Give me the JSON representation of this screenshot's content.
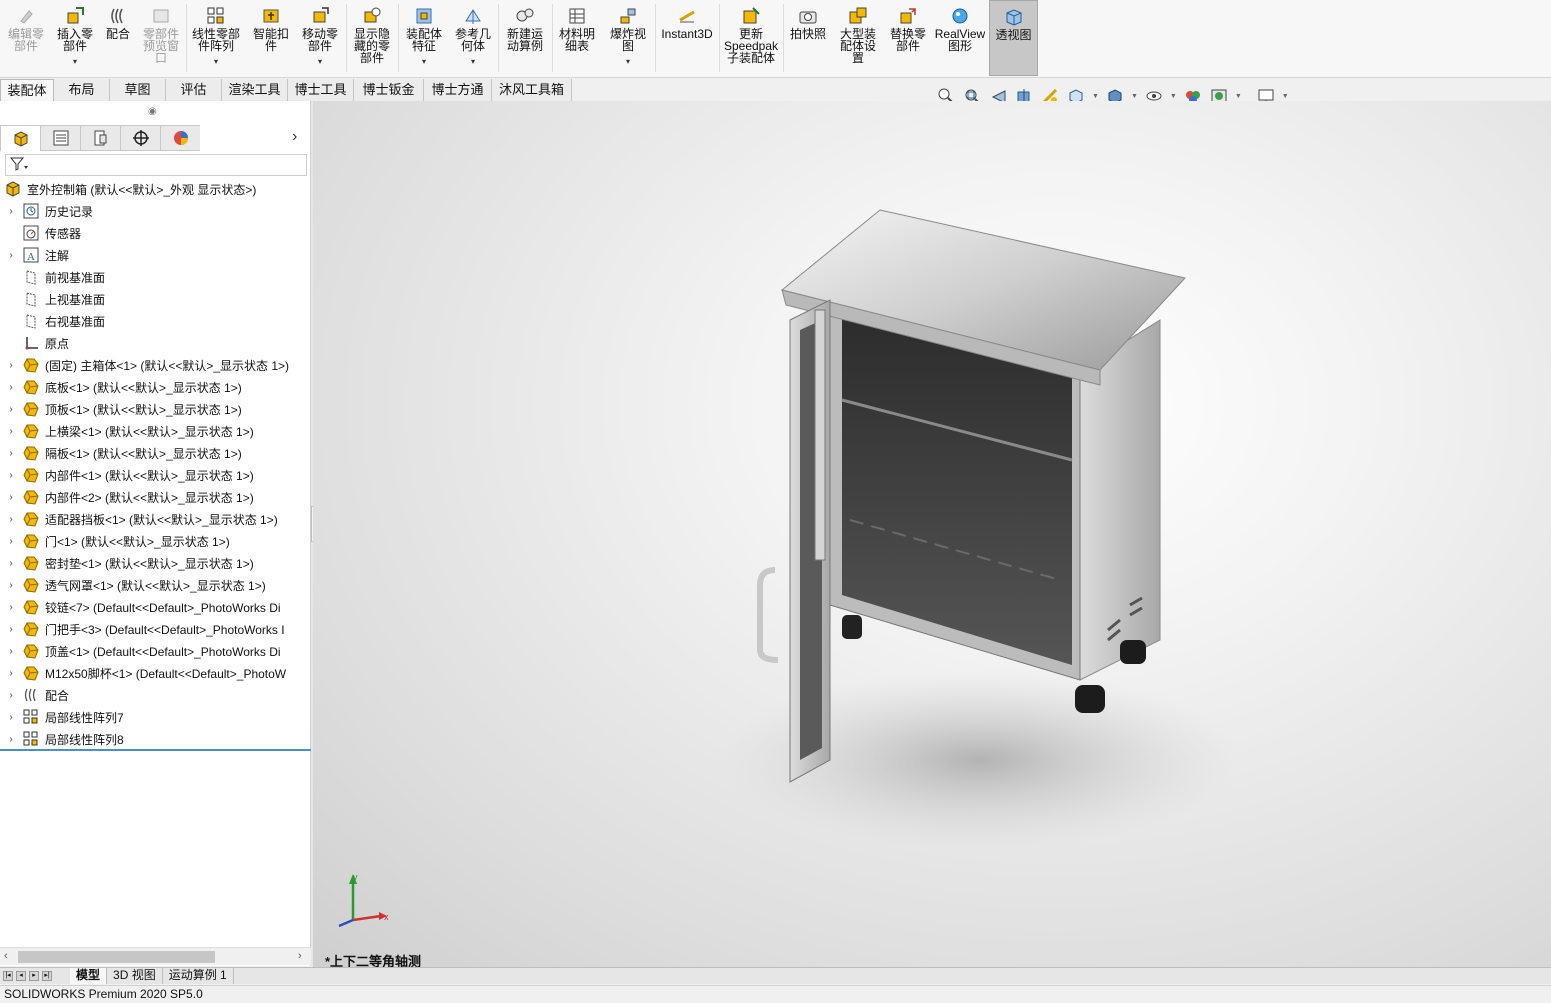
{
  "ribbon": {
    "buttons": [
      {
        "label": "编辑零\n部件",
        "icon": "edit-component-icon",
        "disabled": true
      },
      {
        "label": "插入零\n部件",
        "icon": "insert-component-icon",
        "dropdown": true
      },
      {
        "label": "配合",
        "icon": "mate-icon"
      },
      {
        "label": "零部件\n预览窗\n口",
        "icon": "preview-window-icon",
        "disabled": true
      },
      {
        "label": "线性零部\n件阵列",
        "icon": "linear-pattern-icon",
        "dropdown": true
      },
      {
        "label": "智能扣\n件",
        "icon": "smart-fastener-icon"
      },
      {
        "label": "移动零\n部件",
        "icon": "move-component-icon",
        "dropdown": true
      },
      {
        "label": "显示隐\n藏的零\n部件",
        "icon": "show-hidden-icon"
      },
      {
        "label": "装配体\n特征",
        "icon": "assembly-feature-icon",
        "dropdown": true
      },
      {
        "label": "参考几\n何体",
        "icon": "reference-geometry-icon",
        "dropdown": true
      },
      {
        "label": "新建运\n动算例",
        "icon": "motion-study-icon"
      },
      {
        "label": "材料明\n细表",
        "icon": "bom-icon"
      },
      {
        "label": "爆炸视\n图",
        "icon": "exploded-view-icon",
        "dropdown": true
      },
      {
        "label": "Instant3D",
        "icon": "instant3d-icon"
      },
      {
        "label": "更新\nSpeedpak\n子装配体",
        "icon": "speedpak-icon"
      },
      {
        "label": "拍快照",
        "icon": "snapshot-icon"
      },
      {
        "label": "大型装\n配体设\n置",
        "icon": "large-assembly-icon"
      },
      {
        "label": "替换零\n部件",
        "icon": "replace-component-icon"
      },
      {
        "label": "RealView\n图形",
        "icon": "realview-icon"
      },
      {
        "label": "透视图",
        "icon": "perspective-icon",
        "active": true
      }
    ]
  },
  "command_tabs": [
    "装配体",
    "布局",
    "草图",
    "评估",
    "渲染工具",
    "博士工具",
    "博士钣金",
    "博士方通",
    "沐风工具箱"
  ],
  "heads_up": [
    "zoom-to-fit-icon",
    "zoom-area-icon",
    "previous-view-icon",
    "section-view-icon",
    "dynamic-annotation-icon",
    "view-orientation-icon",
    "display-style-icon",
    "hide-show-icon",
    "edit-appearance-icon",
    "apply-scene-icon",
    "view-settings-icon"
  ],
  "panel": {
    "tabs": [
      "featuremanager-tab-icon",
      "propertymanager-tab-icon",
      "configurationmanager-tab-icon",
      "dimxpert-tab-icon",
      "display-manager-tab-icon"
    ],
    "filter_icon": "filter-icon"
  },
  "tree": {
    "root": "室外控制箱  (默认<<默认>_外观 显示状态>)",
    "items": [
      {
        "label": "历史记录",
        "icon": "history-icon",
        "expandable": true
      },
      {
        "label": "传感器",
        "icon": "sensor-icon",
        "expandable": false
      },
      {
        "label": "注解",
        "icon": "annotation-icon",
        "expandable": true
      },
      {
        "label": "前视基准面",
        "icon": "plane-icon",
        "expandable": false
      },
      {
        "label": "上视基准面",
        "icon": "plane-icon",
        "expandable": false
      },
      {
        "label": "右视基准面",
        "icon": "plane-icon",
        "expandable": false
      },
      {
        "label": "原点",
        "icon": "origin-icon",
        "expandable": false
      },
      {
        "label": "(固定) 主箱体<1> (默认<<默认>_显示状态 1>)",
        "icon": "part-icon",
        "expandable": true
      },
      {
        "label": "底板<1> (默认<<默认>_显示状态 1>)",
        "icon": "part-icon",
        "expandable": true
      },
      {
        "label": "顶板<1> (默认<<默认>_显示状态 1>)",
        "icon": "part-icon",
        "expandable": true
      },
      {
        "label": "上横梁<1> (默认<<默认>_显示状态 1>)",
        "icon": "part-icon",
        "expandable": true
      },
      {
        "label": "隔板<1> (默认<<默认>_显示状态 1>)",
        "icon": "part-icon",
        "expandable": true
      },
      {
        "label": "内部件<1> (默认<<默认>_显示状态 1>)",
        "icon": "part-icon",
        "expandable": true
      },
      {
        "label": "内部件<2> (默认<<默认>_显示状态 1>)",
        "icon": "part-icon",
        "expandable": true
      },
      {
        "label": "适配器挡板<1> (默认<<默认>_显示状态 1>)",
        "icon": "part-icon",
        "expandable": true
      },
      {
        "label": "门<1> (默认<<默认>_显示状态 1>)",
        "icon": "part-icon",
        "expandable": true
      },
      {
        "label": "密封垫<1> (默认<<默认>_显示状态 1>)",
        "icon": "part-icon",
        "expandable": true
      },
      {
        "label": "透气网罩<1> (默认<<默认>_显示状态 1>)",
        "icon": "part-icon",
        "expandable": true
      },
      {
        "label": "铰链<7> (Default<<Default>_PhotoWorks Di",
        "icon": "part-icon",
        "expandable": true
      },
      {
        "label": "门把手<3> (Default<<Default>_PhotoWorks I",
        "icon": "part-icon",
        "expandable": true
      },
      {
        "label": "顶盖<1> (Default<<Default>_PhotoWorks Di",
        "icon": "part-icon",
        "expandable": true
      },
      {
        "label": "M12x50脚杯<1> (Default<<Default>_PhotoW",
        "icon": "part-icon",
        "expandable": true
      },
      {
        "label": "配合",
        "icon": "mates-folder-icon",
        "expandable": true
      },
      {
        "label": "局部线性阵列7",
        "icon": "pattern-icon",
        "expandable": true
      },
      {
        "label": "局部线性阵列8",
        "icon": "pattern-icon",
        "expandable": true
      }
    ]
  },
  "viewport": {
    "view_name": "*上下二等角轴测",
    "triad": {
      "x": "x",
      "y": "y"
    }
  },
  "bottom_tabs": [
    "模型",
    "3D 视图",
    "运动算例 1"
  ],
  "status_bar": "SOLIDWORKS Premium 2020 SP5.0",
  "colors": {
    "accent": "#4a90c8",
    "part": "#f5b800",
    "active_button": "#c7c7c7"
  }
}
